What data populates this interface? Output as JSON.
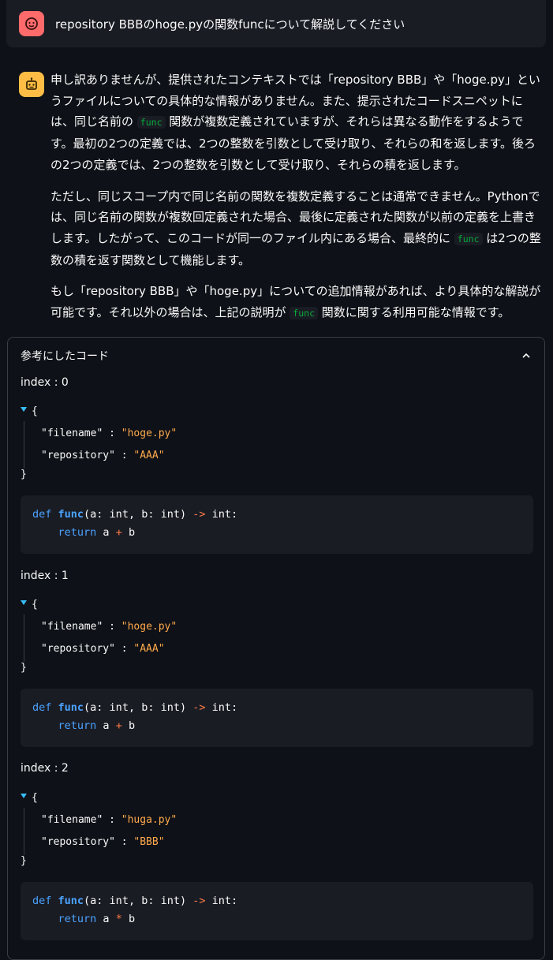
{
  "user_message": "repository BBBのhoge.pyの関数funcについて解説してください",
  "assistant": {
    "p1": [
      "申し訳ありませんが、提供されたコンテキストでは「repository BBB」や「hoge.py」とい",
      "うファイルについての具体的な情報がありません。また、提示されたコードスニペットに",
      "は、同じ名前の",
      "func",
      "関数が複数定義されていますが、それらは異なる動作をするようで",
      "す。最初の2つの定義では、2つの整数を引数として受け取り、それらの和を返します。後",
      "ろの2つの定義では、2つの整数を引数として受け取り、それらの積を返します。"
    ],
    "p2": [
      "ただし、同じスコープ内で同じ名前の関数を複数定義することは通常できません。Python",
      "では、同じ名前の関数が複数回定義された場合、最後に定義された関数が以前の定義を上",
      "書きします。したがって、このコードが同一のファイル内にある場合、最終的に",
      "func",
      "は2",
      "つの整数の積を返す関数として機能します。"
    ],
    "p3": [
      "もし「repository BBB」や「hoge.py」についての追加情報があれば、より具体的な解説が",
      "可能です。それ以外の場合は、上記の説明が",
      "func",
      "関数に関する利用可能な情報です。"
    ]
  },
  "expander": {
    "title": "参考にしたコード",
    "entries": [
      {
        "index_label": "index : 0",
        "filename_key": "\"filename\"",
        "filename": "\"hoge.py\"",
        "repository_key": "\"repository\"",
        "repository": "\"AAA\"",
        "code_line1": [
          "def",
          " ",
          "func",
          "(a: int, b: int) ",
          "->",
          " int:"
        ],
        "code_line2": [
          "    ",
          "return",
          " a ",
          "+",
          " b"
        ]
      },
      {
        "index_label": "index : 1",
        "filename_key": "\"filename\"",
        "filename": "\"hoge.py\"",
        "repository_key": "\"repository\"",
        "repository": "\"AAA\"",
        "code_line1": [
          "def",
          " ",
          "func",
          "(a: int, b: int) ",
          "->",
          " int:"
        ],
        "code_line2": [
          "    ",
          "return",
          " a ",
          "+",
          " b"
        ]
      },
      {
        "index_label": "index : 2",
        "filename_key": "\"filename\"",
        "filename": "\"huga.py\"",
        "repository_key": "\"repository\"",
        "repository": "\"BBB\"",
        "code_line1": [
          "def",
          " ",
          "func",
          "(a: int, b: int) ",
          "->",
          " int:"
        ],
        "code_line2": [
          "    ",
          "return",
          " a ",
          "*",
          " b"
        ]
      }
    ],
    "json_open": "{",
    "json_close": "}",
    "colon": ":"
  },
  "icons": {
    "user_avatar": "face-icon",
    "assistant_avatar": "robot-icon",
    "collapse": "chevron-up-icon"
  },
  "colors": {
    "background": "#0e1117",
    "user_avatar": "#ff6b6b",
    "assistant_avatar": "#ffbd45",
    "inline_code": "#09ab3b",
    "json_value": "#ffa94d",
    "keyword": "#4aa3ff",
    "operator": "#ff7a45"
  }
}
